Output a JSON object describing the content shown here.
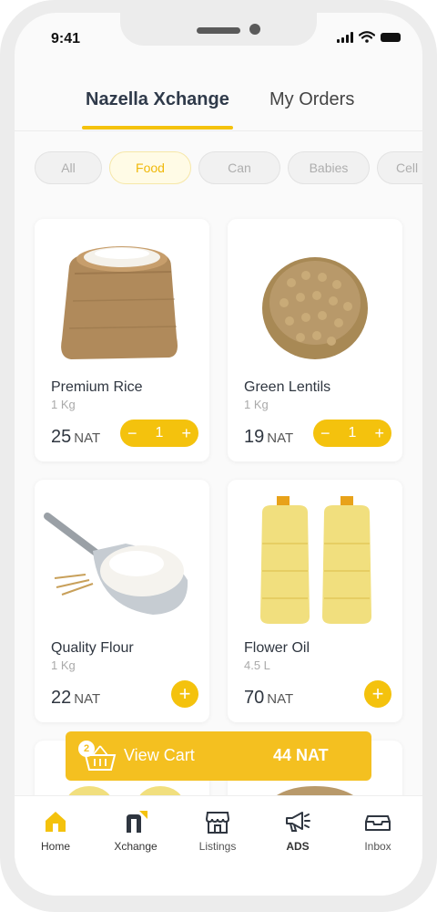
{
  "status": {
    "time": "9:41"
  },
  "tabs": [
    {
      "label": "Nazella Xchange",
      "active": true
    },
    {
      "label": "My Orders",
      "active": false
    }
  ],
  "categories": [
    {
      "label": "All",
      "active": false
    },
    {
      "label": "Food",
      "active": true
    },
    {
      "label": "Can",
      "active": false
    },
    {
      "label": "Babies",
      "active": false
    },
    {
      "label": "Cell",
      "active": false
    }
  ],
  "products": [
    {
      "name": "Premium Rice",
      "unit": "1 Kg",
      "price": "25",
      "currency": "NAT",
      "quantity": "1",
      "icon": "rice-sack-image"
    },
    {
      "name": "Green Lentils",
      "unit": "1 Kg",
      "price": "19",
      "currency": "NAT",
      "quantity": "1",
      "icon": "lentils-pile-image"
    },
    {
      "name": "Quality Flour",
      "unit": "1 Kg",
      "price": "22",
      "currency": "NAT",
      "quantity": "",
      "icon": "flour-scoop-image"
    },
    {
      "name": "Flower Oil",
      "unit": "4.5 L",
      "price": "70",
      "currency": "NAT",
      "quantity": "",
      "icon": "oil-bottles-image"
    }
  ],
  "cart": {
    "count": "2",
    "label": "View Cart",
    "total": "44 NAT"
  },
  "nav": [
    {
      "label": "Home",
      "icon": "home-icon"
    },
    {
      "label": "Xchange",
      "icon": "xchange-icon"
    },
    {
      "label": "Listings",
      "icon": "store-icon"
    },
    {
      "label": "ADS",
      "icon": "megaphone-icon"
    },
    {
      "label": "Inbox",
      "icon": "inbox-icon"
    }
  ],
  "colors": {
    "accent": "#f4c20d",
    "text": "#2f3640",
    "muted": "#aaaaaa"
  }
}
